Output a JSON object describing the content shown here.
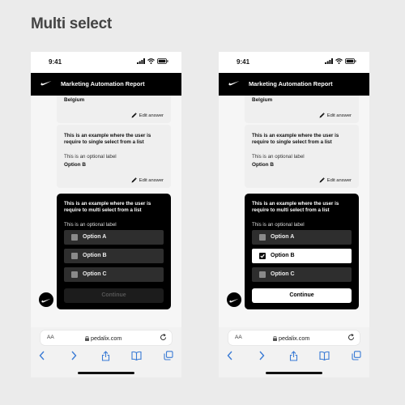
{
  "page": {
    "title": "Multi select"
  },
  "colors": {
    "header_bg": "#000000",
    "link_blue": "#3a7bd5",
    "option_bg": "#2e2e2e"
  },
  "phones": [
    {
      "status": {
        "time": "9:41"
      },
      "header": {
        "title": "Marketing Automation Report",
        "logo_icon": "swoosh-logo"
      },
      "answer_card": {
        "answer": "Belgium",
        "edit_label": "Edit answer"
      },
      "single_card": {
        "question": "This is an example where the user is require to single select from a list",
        "label": "This is an optional label",
        "answer": "Option B",
        "edit_label": "Edit answer"
      },
      "multi_card": {
        "question": "This is an example where the user is require to multi select from a list",
        "label": "This is an optional label",
        "options": [
          {
            "label": "Option A",
            "checked": false
          },
          {
            "label": "Option B",
            "checked": false
          },
          {
            "label": "Option C",
            "checked": false
          }
        ],
        "continue_label": "Continue",
        "continue_enabled": false
      },
      "browser": {
        "text_size_label": "AA",
        "url": "pedalix.com"
      }
    },
    {
      "status": {
        "time": "9:41"
      },
      "header": {
        "title": "Marketing Automation Report",
        "logo_icon": "swoosh-logo"
      },
      "answer_card": {
        "answer": "Belgium",
        "edit_label": "Edit answer"
      },
      "single_card": {
        "question": "This is an example where the user is require to single select from a list",
        "label": "This is an optional label",
        "answer": "Option B",
        "edit_label": "Edit answer"
      },
      "multi_card": {
        "question": "This is an example where the user is require to multi select from a list",
        "label": "This is an optional label",
        "options": [
          {
            "label": "Option A",
            "checked": false
          },
          {
            "label": "Option B",
            "checked": true
          },
          {
            "label": "Option C",
            "checked": false
          }
        ],
        "continue_label": "Continue",
        "continue_enabled": true
      },
      "browser": {
        "text_size_label": "AA",
        "url": "pedalix.com"
      }
    }
  ]
}
